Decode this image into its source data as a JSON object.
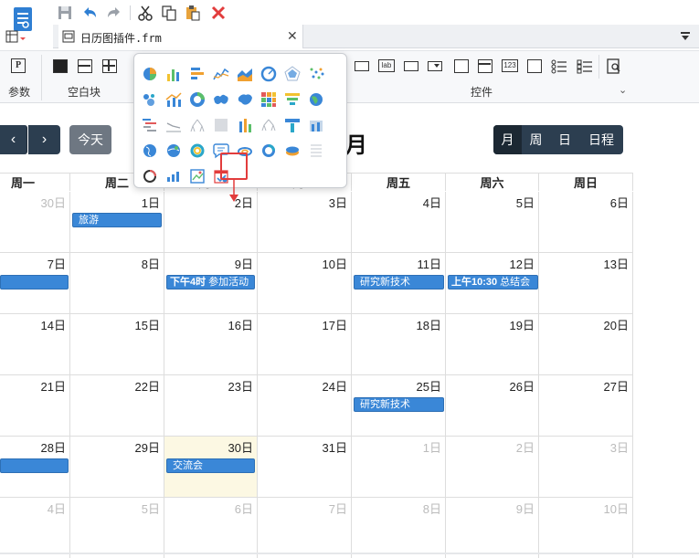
{
  "file_tab": {
    "name": "日历图插件.frm"
  },
  "ribbon": {
    "groups": [
      {
        "label": "参数"
      },
      {
        "label": "空白块"
      },
      {
        "label": "控件"
      }
    ],
    "param_icon_letter": "P",
    "control_text_icon": "lab",
    "control_num_icon": "123"
  },
  "calendar": {
    "nav": {
      "prev": "‹",
      "next": "›",
      "today": "今天"
    },
    "title_suffix": "月",
    "views": [
      "月",
      "周",
      "日",
      "日程"
    ],
    "weekdays": [
      "周一",
      "周二",
      "周三",
      "周四",
      "周五",
      "周六",
      "周日"
    ],
    "weeks": [
      [
        "30日",
        "1日",
        "2日",
        "3日",
        "4日",
        "5日",
        "6日"
      ],
      [
        "7日",
        "8日",
        "9日",
        "10日",
        "11日",
        "12日",
        "13日"
      ],
      [
        "14日",
        "15日",
        "16日",
        "17日",
        "18日",
        "19日",
        "20日"
      ],
      [
        "21日",
        "22日",
        "23日",
        "24日",
        "25日",
        "26日",
        "27日"
      ],
      [
        "28日",
        "29日",
        "30日",
        "31日",
        "1日",
        "2日",
        "3日"
      ],
      [
        "4日",
        "5日",
        "6日",
        "7日",
        "8日",
        "9日",
        "10日"
      ]
    ],
    "events": [
      {
        "text": "旅游",
        "bold": ""
      },
      {
        "text": "",
        "bold": ""
      },
      {
        "text": "参加活动",
        "bold": "下午4时"
      },
      {
        "text": "研究新技术",
        "bold": ""
      },
      {
        "text": "总结会",
        "bold": "上午10:30"
      },
      {
        "text": "研究新技术",
        "bold": ""
      },
      {
        "text": "",
        "bold": ""
      },
      {
        "text": "交流会",
        "bold": ""
      }
    ]
  },
  "colors": {
    "accent": "#3a87d7",
    "nav": "#2c3e50",
    "highlight": "#e23c3c",
    "today_bg": "#fcf8e3"
  }
}
